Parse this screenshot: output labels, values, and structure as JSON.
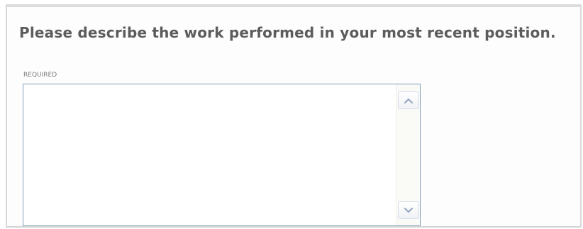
{
  "question": {
    "text": "Please describe the work performed in your most recent position."
  },
  "field": {
    "required_label": "REQUIRED",
    "value": "",
    "placeholder": ""
  },
  "scrollbar": {
    "up_icon": "chevron-up-icon",
    "down_icon": "chevron-down-icon"
  },
  "colors": {
    "question_text": "#5c5c5c",
    "field_border": "#7f9db9",
    "scroll_arrow": "#9aa8c4"
  }
}
